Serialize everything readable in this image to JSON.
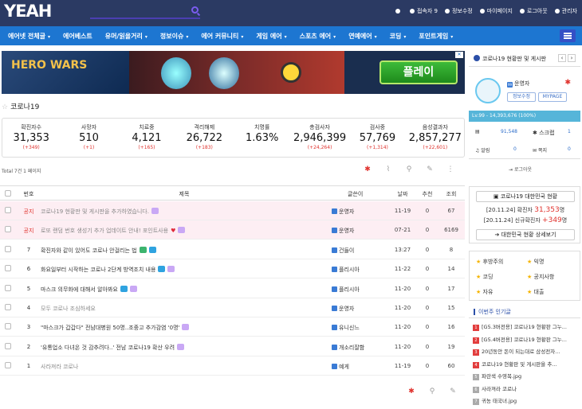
{
  "site": {
    "logo": "YEAH"
  },
  "top_links": [
    "",
    "접속자 9",
    "정보수정",
    "마이페이지",
    "로그아웃",
    "관리자"
  ],
  "nav": [
    {
      "label": "에어넷 전체글",
      "caret": true
    },
    {
      "label": "에어베스트",
      "caret": false
    },
    {
      "label": "유머/읽을거리",
      "caret": true
    },
    {
      "label": "정보이슈",
      "caret": true
    },
    {
      "label": "에어 커뮤니티",
      "caret": true
    },
    {
      "label": "게임 에어",
      "caret": true
    },
    {
      "label": "스포츠 에어",
      "caret": true
    },
    {
      "label": "연예에어",
      "caret": true
    },
    {
      "label": "코딩",
      "caret": true
    },
    {
      "label": "포인트게임",
      "caret": true
    }
  ],
  "ad": {
    "brand": "HERO WARS",
    "cta": "플레이"
  },
  "page_title": "코로나19",
  "stats": [
    {
      "label": "확진자수",
      "value": "31,353",
      "delta": "(+349)"
    },
    {
      "label": "사망자",
      "value": "510",
      "delta": "(+1)"
    },
    {
      "label": "치료중",
      "value": "4,121",
      "delta": "(+165)"
    },
    {
      "label": "격리해제",
      "value": "26,722",
      "delta": "(+183)"
    },
    {
      "label": "치명률",
      "value": "1.63%",
      "delta": ""
    },
    {
      "label": "총검사자",
      "value": "2,946,399",
      "delta": "(+24,264)"
    },
    {
      "label": "검사중",
      "value": "57,769",
      "delta": "(+1,314)"
    },
    {
      "label": "음성결과자",
      "value": "2,857,277",
      "delta": "(+22,601)"
    }
  ],
  "meta": "Total 7건 1 페이지",
  "columns": {
    "no": "번호",
    "title": "제목",
    "author": "글쓴이",
    "date": "날짜",
    "rec": "추천",
    "views": "조회"
  },
  "posts": [
    {
      "no": "공지",
      "title": "코로나19 현황판 및 게시판을 추가하였습니다.",
      "author": "운영자",
      "date": "11-19",
      "rec": "0",
      "views": "67",
      "notice": true,
      "badges": [
        "p"
      ]
    },
    {
      "no": "공지",
      "title": "로또 랜덤 번호 생성기 추가 업데이트 안내! 포인트사용",
      "author": "운영자",
      "date": "07-21",
      "rec": "0",
      "views": "6169",
      "notice": true,
      "badges": [
        "heart",
        "p"
      ]
    },
    {
      "no": "7",
      "title": "확진자와 같이 있어도 코로나 안걸리는 법",
      "author": "건들이",
      "date": "13:27",
      "rec": "0",
      "views": "8",
      "notice": false,
      "badges": [
        "n",
        "img"
      ]
    },
    {
      "no": "6",
      "title": "화요일부터 시작하는 코로나 2단계 방역조치 내용",
      "author": "플리시아",
      "date": "11-22",
      "rec": "0",
      "views": "14",
      "notice": false,
      "badges": [
        "img",
        "p"
      ]
    },
    {
      "no": "5",
      "title": "마스크 의무화에 대해서 알아봐요",
      "author": "플리시아",
      "date": "11-20",
      "rec": "0",
      "views": "17",
      "notice": false,
      "badges": [
        "img",
        "p"
      ]
    },
    {
      "no": "4",
      "title": "모두 코로나 조심하세요",
      "author": "운영자",
      "date": "11-20",
      "rec": "0",
      "views": "15",
      "notice": false,
      "badges": [],
      "dim": true
    },
    {
      "no": "3",
      "title": "\"마스크가 갑갑다\" 전남대병원 50명..조중고 추가감염 '0명'",
      "author": "유니신느",
      "date": "11-20",
      "rec": "0",
      "views": "16",
      "notice": false,
      "badges": [
        "p"
      ]
    },
    {
      "no": "2",
      "title": "'유통업소 다녀온 것 감추려다..' 전남 코로나19 확산 우려",
      "author": "개소리잘함",
      "date": "11-20",
      "rec": "0",
      "views": "19",
      "notice": false,
      "badges": [
        "p"
      ]
    },
    {
      "no": "1",
      "title": "사라져라 코로나",
      "author": "예게",
      "date": "11-19",
      "rec": "0",
      "views": "60",
      "notice": false,
      "badges": [],
      "dim": true
    }
  ],
  "side": {
    "tab": "코로나19 현황판 및 게시판",
    "user": "운영자",
    "edit": "정보수정",
    "mypage": "MYPAGE",
    "level": "Lv.99 - 14,393,676 (100%)",
    "points": "91,548",
    "scrap_label": "스크랩",
    "scrap": "1",
    "alarm_label": "알림",
    "alarm": "0",
    "note_label": "쪽지",
    "note": "0",
    "logout": "로그아웃",
    "covid_btn": "코로나19 대한민국 현황",
    "covid_line1_pre": "[20.11.24] 확진자",
    "covid_line1_val": "31,353",
    "covid_line1_suf": "명",
    "covid_line2_pre": "[20.11.24] 신규확진자",
    "covid_line2_val": "+349",
    "covid_line2_suf": "명",
    "covid_detail": "대한민국 현황 상세보기",
    "cats": [
      "후방주의",
      "익명",
      "코딩",
      "공지사항",
      "자유",
      "대출"
    ],
    "popular_title": "이번주 인기글",
    "popular": [
      {
        "rank": "1",
        "text": "[G5.3버전용] 코로나19 현황판 그누..."
      },
      {
        "rank": "2",
        "text": "[G5.4버전용] 코로나19 현황판 그누..."
      },
      {
        "rank": "3",
        "text": "20년동안 돈이 되는대로 삼성전자..."
      },
      {
        "rank": "4",
        "text": "코로나19 현황판 및 게시판을 추..."
      },
      {
        "rank": "5",
        "text": "파란색 수영복.jpg"
      },
      {
        "rank": "6",
        "text": "사라져라 코로나"
      },
      {
        "rank": "7",
        "text": "귀농 태국녀.jpg"
      }
    ]
  }
}
